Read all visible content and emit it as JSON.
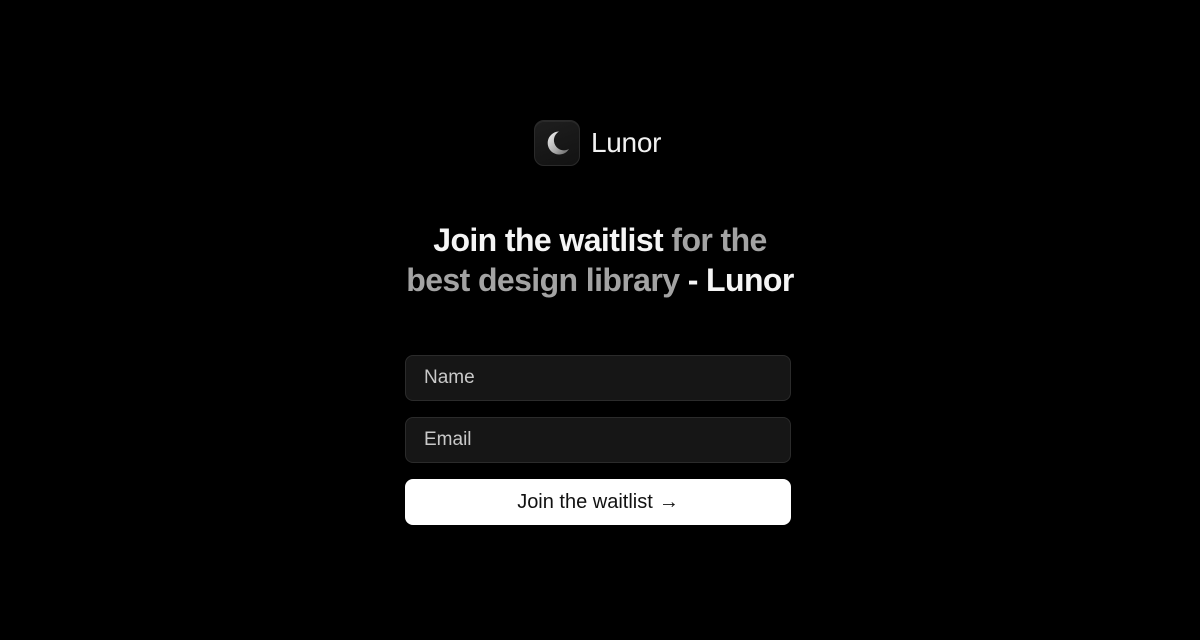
{
  "brand": {
    "name": "Lunor",
    "logo_icon": "crescent-moon-icon"
  },
  "headline": {
    "part1": "Join the waitlist",
    "part2": " for the",
    "part3": "best design library",
    "part4": " - Lunor"
  },
  "form": {
    "name_placeholder": "Name",
    "email_placeholder": "Email",
    "submit_label": "Join the waitlist",
    "submit_arrow": "→"
  },
  "colors": {
    "background": "#000000",
    "headline_strong": "#f5f5f5",
    "headline_muted": "#a3a3a3",
    "input_bg": "#161616",
    "button_bg": "#ffffff",
    "button_text": "#111111"
  }
}
